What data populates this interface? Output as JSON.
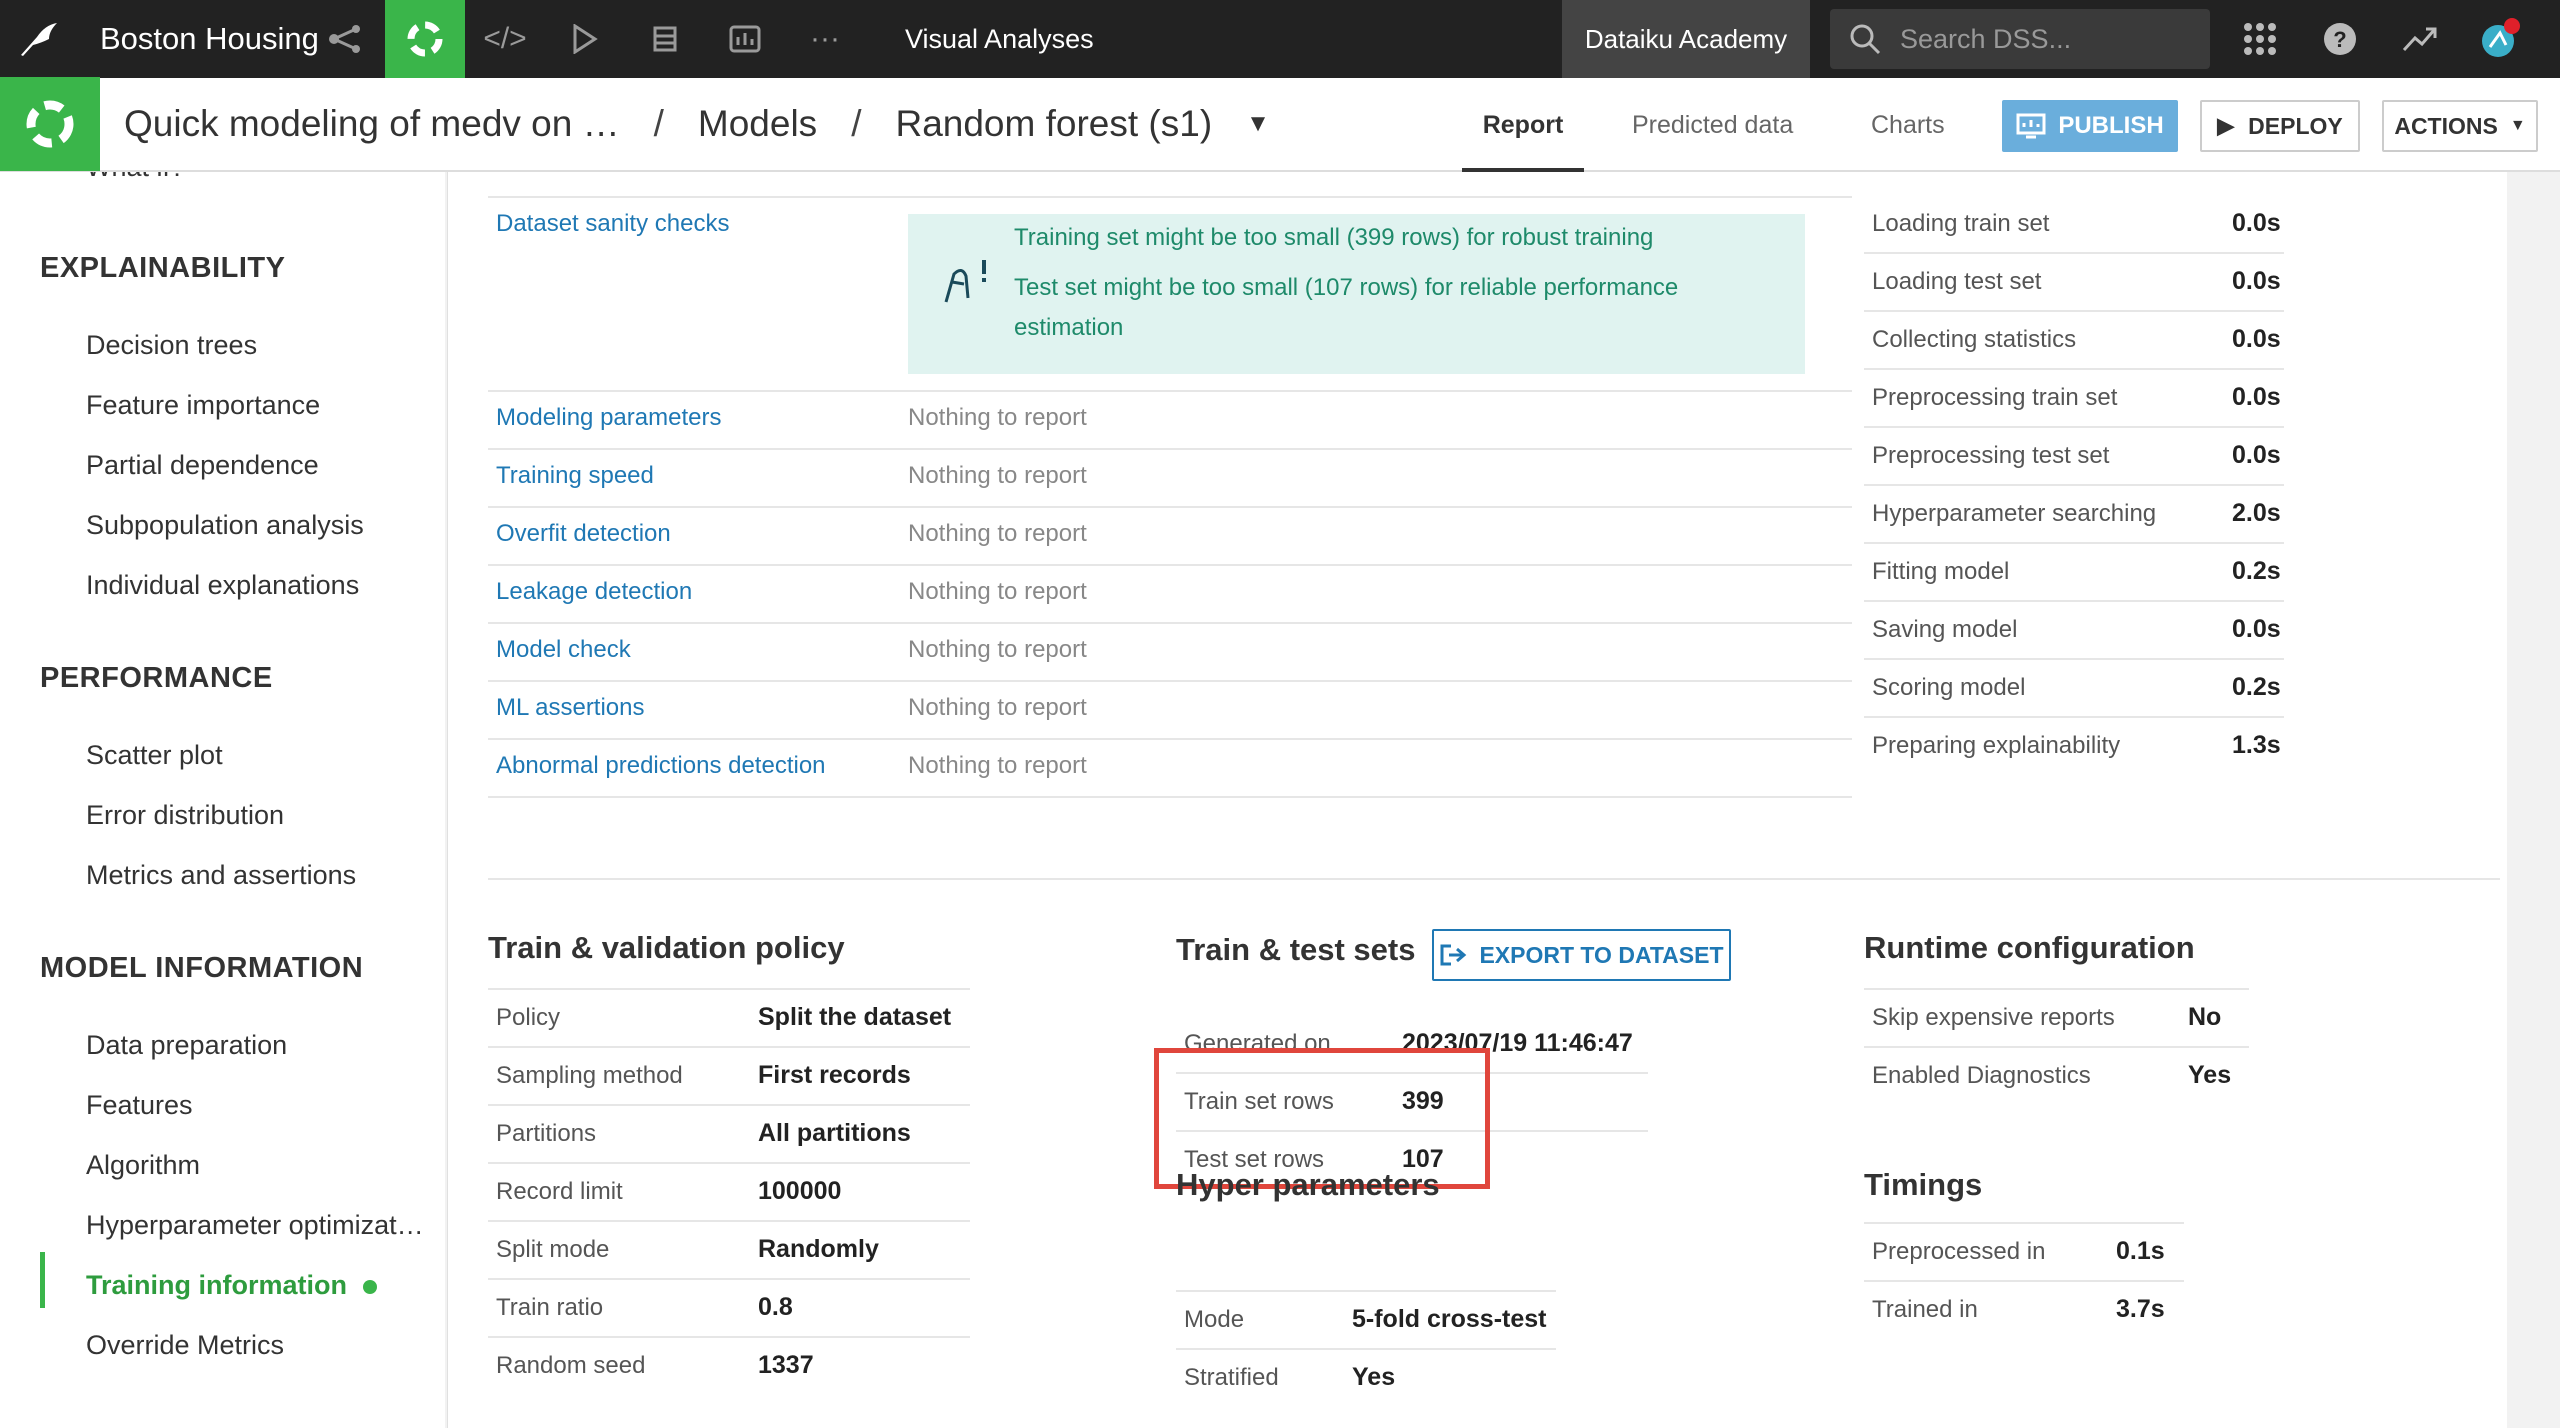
{
  "topbar": {
    "project": "Boston Housing",
    "title": "Visual Analyses",
    "academy": "Dataiku Academy",
    "search_placeholder": "Search DSS..."
  },
  "subbar": {
    "breadcrumb": [
      "Quick modeling of medv on …",
      "Models",
      "Random forest (s1)"
    ],
    "separator": "/",
    "tabs": [
      "Report",
      "Predicted data",
      "Charts"
    ],
    "active_tab": "Report",
    "publish_label": "PUBLISH",
    "deploy_label": "DEPLOY",
    "actions_label": "ACTIONS"
  },
  "sidebar": {
    "cut_item": "What if?",
    "sections": [
      {
        "title": "EXPLAINABILITY",
        "items": [
          "Decision trees",
          "Feature importance",
          "Partial dependence",
          "Subpopulation analysis",
          "Individual explanations"
        ]
      },
      {
        "title": "PERFORMANCE",
        "items": [
          "Scatter plot",
          "Error distribution",
          "Metrics and assertions"
        ]
      },
      {
        "title": "MODEL INFORMATION",
        "items": [
          "Data preparation",
          "Features",
          "Algorithm",
          "Hyperparameter optimizat…",
          "Training information",
          "Override Metrics"
        ]
      }
    ],
    "active_item": "Training information"
  },
  "diagnostics": {
    "rows": [
      {
        "label": "Dataset sanity checks"
      },
      {
        "label": "Modeling parameters",
        "value": "Nothing to report"
      },
      {
        "label": "Training speed",
        "value": "Nothing to report"
      },
      {
        "label": "Overfit detection",
        "value": "Nothing to report"
      },
      {
        "label": "Leakage detection",
        "value": "Nothing to report"
      },
      {
        "label": "Model check",
        "value": "Nothing to report"
      },
      {
        "label": "ML assertions",
        "value": "Nothing to report"
      },
      {
        "label": "Abnormal predictions detection",
        "value": "Nothing to report"
      }
    ],
    "alert_lines": [
      "Training set might be too small (399 rows) for robust training",
      "Test set might be too small (107 rows) for reliable performance",
      "estimation"
    ]
  },
  "train_timings": [
    {
      "k": "Loading train set",
      "v": "0.0s"
    },
    {
      "k": "Loading test set",
      "v": "0.0s"
    },
    {
      "k": "Collecting statistics",
      "v": "0.0s"
    },
    {
      "k": "Preprocessing train set",
      "v": "0.0s"
    },
    {
      "k": "Preprocessing test set",
      "v": "0.0s"
    },
    {
      "k": "Hyperparameter searching",
      "v": "2.0s"
    },
    {
      "k": "Fitting model",
      "v": "0.2s"
    },
    {
      "k": "Saving model",
      "v": "0.0s"
    },
    {
      "k": "Scoring model",
      "v": "0.2s"
    },
    {
      "k": "Preparing explainability",
      "v": "1.3s"
    }
  ],
  "policy": {
    "title": "Train & validation policy",
    "rows": [
      {
        "k": "Policy",
        "v": "Split the dataset"
      },
      {
        "k": "Sampling method",
        "v": "First records"
      },
      {
        "k": "Partitions",
        "v": "All partitions"
      },
      {
        "k": "Record limit",
        "v": "100000"
      },
      {
        "k": "Split mode",
        "v": "Randomly"
      },
      {
        "k": "Train ratio",
        "v": "0.8"
      },
      {
        "k": "Random seed",
        "v": "1337"
      }
    ]
  },
  "sets": {
    "title": "Train & test sets",
    "export_label": "EXPORT TO DATASET",
    "rows": [
      {
        "k": "Generated on",
        "v": "2023/07/19 11:46:47"
      },
      {
        "k": "Train set rows",
        "v": "399"
      },
      {
        "k": "Test set rows",
        "v": "107"
      }
    ]
  },
  "hyper": {
    "title": "Hyper parameters",
    "rows": [
      {
        "k": "Mode",
        "v": "5-fold cross-test"
      },
      {
        "k": "Stratified",
        "v": "Yes"
      }
    ]
  },
  "runtime": {
    "title": "Runtime configuration",
    "rows": [
      {
        "k": "Skip expensive reports",
        "v": "No"
      },
      {
        "k": "Enabled Diagnostics",
        "v": "Yes"
      }
    ]
  },
  "timings": {
    "title": "Timings",
    "rows": [
      {
        "k": "Preprocessed in",
        "v": "0.1s"
      },
      {
        "k": "Trained in",
        "v": "3.7s"
      }
    ]
  },
  "colors": {
    "accent": "#3ab54a",
    "link": "#1f78b4",
    "highlight": "#e0463c"
  }
}
